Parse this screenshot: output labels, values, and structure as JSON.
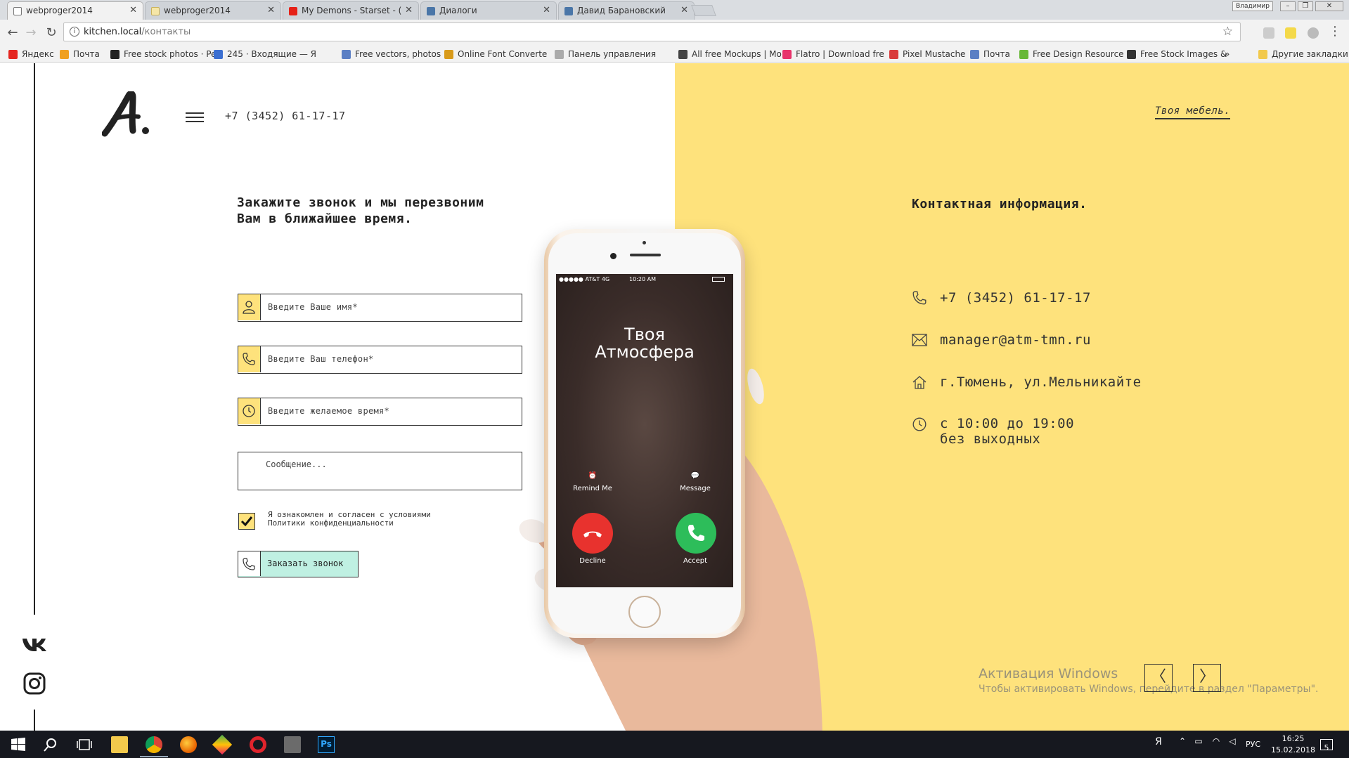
{
  "browser": {
    "tabs": [
      {
        "title": "webproger2014",
        "active": true,
        "icon": "page-icon"
      },
      {
        "title": "webproger2014",
        "active": false,
        "icon": "page-icon"
      },
      {
        "title": "My Demons - Starset - (",
        "active": false,
        "icon": "youtube-icon"
      },
      {
        "title": "Диалоги",
        "active": false,
        "icon": "vk-icon"
      },
      {
        "title": "Давид Барановский",
        "active": false,
        "icon": "vk-icon"
      }
    ],
    "user_name": "Владимир",
    "address": {
      "host": "kitchen.local",
      "path": "/контакты"
    },
    "bookmarks": [
      {
        "label": "Яндекс",
        "icon": "yandex-icon",
        "color": "#e52620"
      },
      {
        "label": "Почта",
        "icon": "mail-icon",
        "color": "#f0a020"
      },
      {
        "label": "Free stock photos · Pe",
        "icon": "camera-icon",
        "color": "#222222"
      },
      {
        "label": "245 · Входящие — Я",
        "icon": "chat-icon",
        "color": "#3b6fd1"
      },
      {
        "label": "Free vectors, photos",
        "icon": "image-icon",
        "color": "#5b7fc4"
      },
      {
        "label": "Online Font Converte",
        "icon": "font-icon",
        "color": "#d89a1a"
      },
      {
        "label": "Панель управления",
        "icon": "doc-icon",
        "color": "#aaaaaa"
      },
      {
        "label": "All free Mockups | Mo",
        "icon": "mockups-icon",
        "color": "#444444"
      },
      {
        "label": "Flatro | Download fre",
        "icon": "flatro-icon",
        "color": "#e8336b"
      },
      {
        "label": "Pixel Mustache",
        "icon": "mustache-icon",
        "color": "#d93b3b"
      },
      {
        "label": "Почта",
        "icon": "mail-icon",
        "color": "#5b7fc4"
      },
      {
        "label": "Free Design Resource",
        "icon": "freedesign-icon",
        "color": "#67b837"
      },
      {
        "label": "Free Stock Images &",
        "icon": "stock-icon",
        "color": "#333333"
      }
    ],
    "more_bookmarks": "»",
    "other_bookmarks": "Другие закладки"
  },
  "page": {
    "header_phone": "+7 (3452) 61-17-17",
    "slogan": "Твоя мебель.",
    "form": {
      "title_lines": [
        "Закажите звонок и мы перезвоним",
        "Вам в ближайшее время."
      ],
      "name_placeholder": "Введите Ваше имя*",
      "phone_placeholder": "Введите Ваш телефон*",
      "time_placeholder": "Введите желаемое время*",
      "message_placeholder": "Сообщение...",
      "agree_lines": [
        "Я ознакомлен и согласен с условиями",
        "Политики конфиденциальности"
      ],
      "agree_checked": true,
      "submit_label": "Заказать звонок"
    },
    "contacts": {
      "title": "Контактная информация.",
      "phone": "+7 (3452) 61-17-17",
      "email": "manager@atm-tmn.ru",
      "address": "г.Тюмень, ул.Мельникайте",
      "hours_line1": "с 10:00 до 19:00",
      "hours_line2": "без выходных"
    },
    "phone_mock": {
      "carrier": "●●●●● AT&T  4G",
      "time": "10:20 AM",
      "caller_line1": "Твоя",
      "caller_line2": "Атмосфера",
      "remind": "Remind Me",
      "message": "Message",
      "decline": "Decline",
      "accept": "Accept"
    },
    "nav": {
      "prev": "〈",
      "next": "〉"
    },
    "windows_activation": {
      "title": "Активация Windows",
      "text": "Чтобы активировать Windows, перейдите в раздел \"Параметры\"."
    }
  },
  "taskbar": {
    "language": "РУС",
    "time": "16:25",
    "date": "15.02.2018",
    "notifications": "5"
  },
  "colors": {
    "accent_yellow": "#fee27c",
    "submit_mint": "#bff0e2",
    "decline_red": "#e8322e",
    "accept_green": "#2dbd5a"
  }
}
